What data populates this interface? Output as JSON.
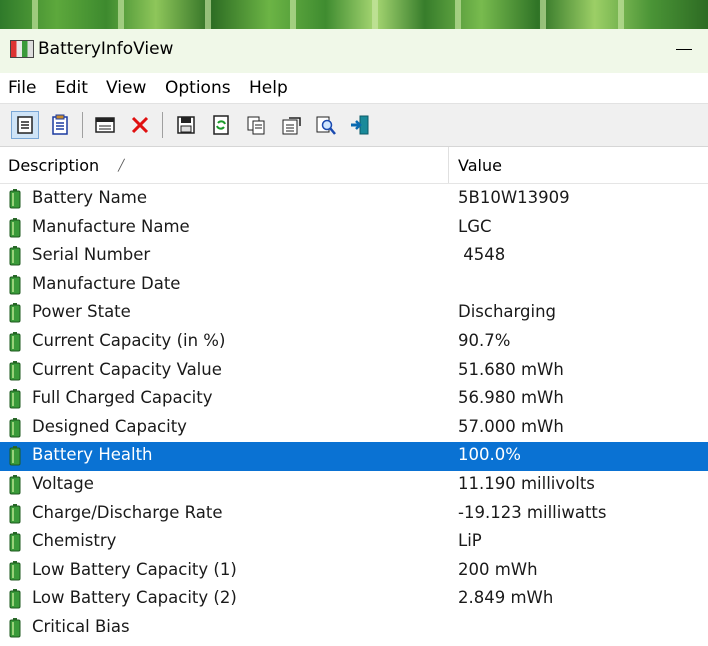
{
  "window": {
    "title": "BatteryInfoView",
    "app_icon": "battery-app-icon"
  },
  "menu": [
    "File",
    "Edit",
    "View",
    "Options",
    "Help"
  ],
  "toolbar": [
    {
      "icon": "html-report-icon"
    },
    {
      "icon": "text-report-icon"
    },
    {
      "icon": "window-icon"
    },
    {
      "icon": "delete-icon"
    },
    {
      "icon": "save-icon"
    },
    {
      "icon": "refresh-icon"
    },
    {
      "icon": "copy-icon"
    },
    {
      "icon": "properties-icon"
    },
    {
      "icon": "find-icon"
    },
    {
      "icon": "exit-icon"
    }
  ],
  "columns": {
    "description": "Description",
    "value": "Value"
  },
  "rows": [
    {
      "description": "Battery Name",
      "value": "5B10W13909"
    },
    {
      "description": "Manufacture Name",
      "value": "LGC"
    },
    {
      "description": "Serial Number",
      "value": " 4548"
    },
    {
      "description": "Manufacture Date",
      "value": ""
    },
    {
      "description": "Power State",
      "value": "Discharging"
    },
    {
      "description": "Current Capacity (in %)",
      "value": "90.7%"
    },
    {
      "description": "Current Capacity Value",
      "value": "51.680 mWh"
    },
    {
      "description": "Full Charged Capacity",
      "value": "56.980 mWh"
    },
    {
      "description": "Designed Capacity",
      "value": "57.000 mWh"
    },
    {
      "description": "Battery Health",
      "value": "100.0%",
      "selected": true
    },
    {
      "description": "Voltage",
      "value": "11.190 millivolts"
    },
    {
      "description": "Charge/Discharge Rate",
      "value": "-19.123 milliwatts"
    },
    {
      "description": "Chemistry",
      "value": "LiP"
    },
    {
      "description": "Low Battery Capacity (1)",
      "value": "200 mWh"
    },
    {
      "description": "Low Battery Capacity (2)",
      "value": "2.849 mWh"
    },
    {
      "description": "Critical Bias",
      "value": ""
    }
  ],
  "colors": {
    "selection": "#0a72d3",
    "battery_green": "#3a9a3a"
  }
}
